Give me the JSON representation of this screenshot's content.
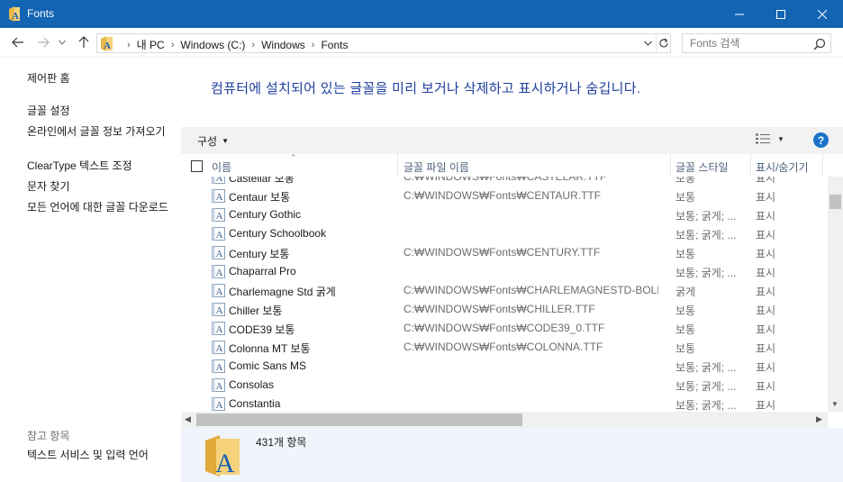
{
  "window": {
    "title": "Fonts",
    "controls": {
      "minimize": "—",
      "maximize": "☐",
      "close": "✕"
    }
  },
  "nav": {
    "back_icon": "arrow-left-icon",
    "forward_icon": "arrow-right-icon",
    "recent_icon": "chevron-down-icon",
    "up_icon": "arrow-up-icon"
  },
  "address": {
    "crumbs": [
      "내 PC",
      "Windows (C:)",
      "Windows",
      "Fonts"
    ],
    "separator": "›"
  },
  "search": {
    "placeholder": "Fonts 검색"
  },
  "sidebar": {
    "links": [
      "제어판 홈",
      "글꼴 설정",
      "온라인에서 글꼴 정보 가져오기",
      "ClearType 텍스트 조정",
      "문자 찾기",
      "모든 언어에 대한 글꼴 다운로드"
    ],
    "see_also_label": "참고 항목",
    "see_also_links": [
      "텍스트 서비스 및 입력 언어"
    ]
  },
  "main": {
    "headline": "컴퓨터에 설치되어 있는 글꼴을 미리 보거나 삭제하고 표시하거나 숨깁니다.",
    "organize_label": "구성",
    "columns": [
      "이름",
      "글꼴 파일 이름",
      "글꼴 스타일",
      "표시/숨기기"
    ],
    "rows": [
      {
        "name": "Castellar 보통",
        "file": "C:₩WINDOWS₩Fonts₩CASTELAR.TTF",
        "style": "보통",
        "show": "표시"
      },
      {
        "name": "Centaur 보통",
        "file": "C:₩WINDOWS₩Fonts₩CENTAUR.TTF",
        "style": "보통",
        "show": "표시"
      },
      {
        "name": "Century Gothic",
        "file": "",
        "style": "보통; 굵게; ...",
        "show": "표시"
      },
      {
        "name": "Century Schoolbook",
        "file": "",
        "style": "보통; 굵게; ...",
        "show": "표시"
      },
      {
        "name": "Century 보통",
        "file": "C:₩WINDOWS₩Fonts₩CENTURY.TTF",
        "style": "보통",
        "show": "표시"
      },
      {
        "name": "Chaparral Pro",
        "file": "",
        "style": "보통; 굵게; ...",
        "show": "표시"
      },
      {
        "name": "Charlemagne Std 굵게",
        "file": "C:₩WINDOWS₩Fonts₩CHARLEMAGNESTD-BOLD....",
        "style": "굵게",
        "show": "표시"
      },
      {
        "name": "Chiller 보통",
        "file": "C:₩WINDOWS₩Fonts₩CHILLER.TTF",
        "style": "보통",
        "show": "표시"
      },
      {
        "name": "CODE39 보통",
        "file": "C:₩WINDOWS₩Fonts₩CODE39_0.TTF",
        "style": "보통",
        "show": "표시"
      },
      {
        "name": "Colonna MT 보통",
        "file": "C:₩WINDOWS₩Fonts₩COLONNA.TTF",
        "style": "보통",
        "show": "표시"
      },
      {
        "name": "Comic Sans MS",
        "file": "",
        "style": "보통; 굵게; ...",
        "show": "표시"
      },
      {
        "name": "Consolas",
        "file": "",
        "style": "보통; 굵게; ...",
        "show": "표시"
      },
      {
        "name": "Constantia",
        "file": "",
        "style": "보통; 굵게; ...",
        "show": "표시"
      }
    ]
  },
  "details": {
    "count": "431개 항목"
  },
  "colors": {
    "titlebar": "#1464b4",
    "headline": "#1e3e9c",
    "help": "#1a73c8",
    "details_bg": "#f0f4fb"
  }
}
